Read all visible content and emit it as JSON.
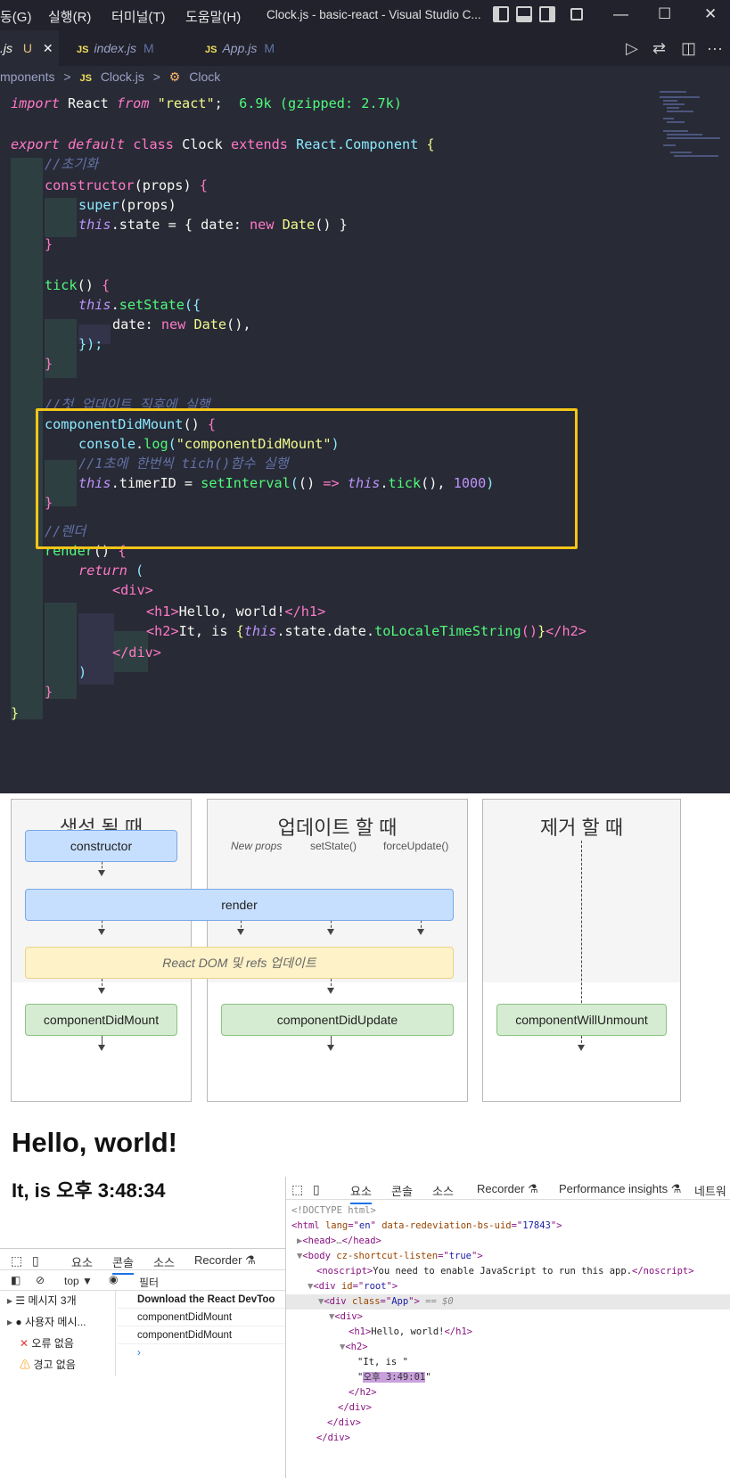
{
  "vscode": {
    "menu": [
      "동(G)",
      "실행(R)",
      "터미널(T)",
      "도움말(H)"
    ],
    "window_title": "Clock.js - basic-react - Visual Studio C...",
    "window_controls": [
      "—",
      "☐",
      "✕"
    ],
    "tabs": [
      {
        "name": "Clock.js",
        "label": ".js",
        "status": "U",
        "active": true
      },
      {
        "name": "index.js",
        "label": "index.js",
        "status": "M",
        "active": false
      },
      {
        "name": "App.js",
        "label": "App.js",
        "status": "M",
        "active": false
      }
    ],
    "breadcrumb": [
      "mponents",
      ">",
      "Clock.js",
      ">",
      "Clock"
    ],
    "import_size": "6.9k (gzipped: 2.7k)",
    "code": {
      "l1": [
        "import",
        " React ",
        "from",
        " ",
        "\"react\"",
        ";  "
      ],
      "l2": [
        "export",
        " ",
        "default",
        " ",
        "class",
        " Clock ",
        "extends",
        " React.Component ",
        "{"
      ],
      "c1": "//초기화",
      "l4": [
        "constructor",
        "(props) ",
        "{"
      ],
      "l5": [
        "super",
        "(props)"
      ],
      "l6": [
        "this",
        ".state = { date: ",
        "new",
        " ",
        "Date",
        "() }"
      ],
      "l7": "}",
      "l9": [
        "tick",
        "() ",
        "{"
      ],
      "l10": [
        "this",
        ".",
        "setState",
        "({"
      ],
      "l11": [
        "date: ",
        "new",
        " ",
        "Date",
        "(),"
      ],
      "l12": "});",
      "l13": "}",
      "c2": "//첫 업데이트 직후에 실행",
      "l15": [
        "componentDidMount",
        "() ",
        "{"
      ],
      "l16": [
        "console",
        ".",
        "log",
        "(",
        "\"componentDidMount\"",
        ")"
      ],
      "c3": "//1초에 한번씩 tich()함수 실행",
      "l18": [
        "this",
        ".timerID = ",
        "setInterval",
        "(",
        "() ",
        "=>",
        " ",
        "this",
        ".",
        "tick",
        "(), ",
        "1000",
        ")"
      ],
      "l19": "}",
      "c4": "//렌더",
      "l21": [
        "render",
        "() ",
        "{"
      ],
      "l22": [
        "return",
        " ("
      ],
      "l23": [
        "<",
        "div",
        ">"
      ],
      "l24": [
        "<",
        "h1",
        ">",
        "Hello, world!",
        "</",
        "h1",
        ">"
      ],
      "l25": [
        "<",
        "h2",
        ">",
        "It, is ",
        "{",
        "this",
        ".state.date.",
        "toLocaleTimeString",
        "()",
        "}",
        "</",
        "h2",
        ">"
      ],
      "l26": [
        "</",
        "div",
        ">"
      ],
      "l27": ")",
      "l28": "}",
      "l29": "}"
    }
  },
  "diagram": {
    "panels": [
      "생성 될 때",
      "업데이트 할 때",
      "제거 할 때"
    ],
    "constructor": "constructor",
    "render": "render",
    "react_dom": "React DOM 및 refs 업데이트",
    "did_mount": "componentDidMount",
    "did_update": "componentDidUpdate",
    "will_unmount": "componentWillUnmount",
    "triggers": [
      "New props",
      "setState()",
      "forceUpdate()"
    ]
  },
  "app_output": {
    "h1": "Hello, world!",
    "h2": "It, is 오후 3:48:34"
  },
  "console": {
    "tabs": [
      "요소",
      "콘솔",
      "소스",
      "Recorder ⚗"
    ],
    "context": "top ▼",
    "filter_placeholder": "필터",
    "sidebar": [
      {
        "icon": "☰",
        "label": "메시지 3개"
      },
      {
        "icon": "●",
        "label": "사용자 메시..."
      },
      {
        "icon": "✕",
        "label": "오류 없음"
      },
      {
        "icon": "⚠",
        "label": "경고 없음"
      }
    ],
    "messages": [
      "Download the React DevToo",
      "componentDidMount",
      "componentDidMount"
    ],
    "prompt": "›"
  },
  "elements": {
    "tabs": [
      "요소",
      "콘솔",
      "소스",
      "Recorder ⚗",
      "Performance insights ⚗",
      "네트워"
    ],
    "doctype": "<!DOCTYPE html>",
    "html_open": [
      "<html ",
      "lang",
      "=\"",
      "en",
      "\" ",
      "data-redeviation-bs-uid",
      "=\"",
      "17843",
      "\">"
    ],
    "head": [
      "▶",
      "<head>",
      "…",
      "</head>"
    ],
    "body_open": [
      "▼",
      "<body ",
      "cz-shortcut-listen",
      "=\"",
      "true",
      "\">"
    ],
    "noscript": [
      "<noscript>",
      "You need to enable JavaScript to run this app.",
      "</noscript>"
    ],
    "root_div": [
      "▼",
      "<div ",
      "id",
      "=\"",
      "root",
      "\">"
    ],
    "app_div": [
      "▼",
      "<div ",
      "class",
      "=\"",
      "App",
      "\">",
      " == $0"
    ],
    "inner_div": [
      "▼",
      "<div>"
    ],
    "h1_node": [
      "<h1>",
      "Hello, world!",
      "</h1>"
    ],
    "h2_open": [
      "▼",
      "<h2>"
    ],
    "h2_text1": "\"It, is \"",
    "h2_text2": [
      "\"",
      "오후 3:49:01",
      "\""
    ],
    "h2_close": "</h2>",
    "div_close1": "</div>",
    "div_close2": "</div>",
    "div_close3": "</div>"
  }
}
